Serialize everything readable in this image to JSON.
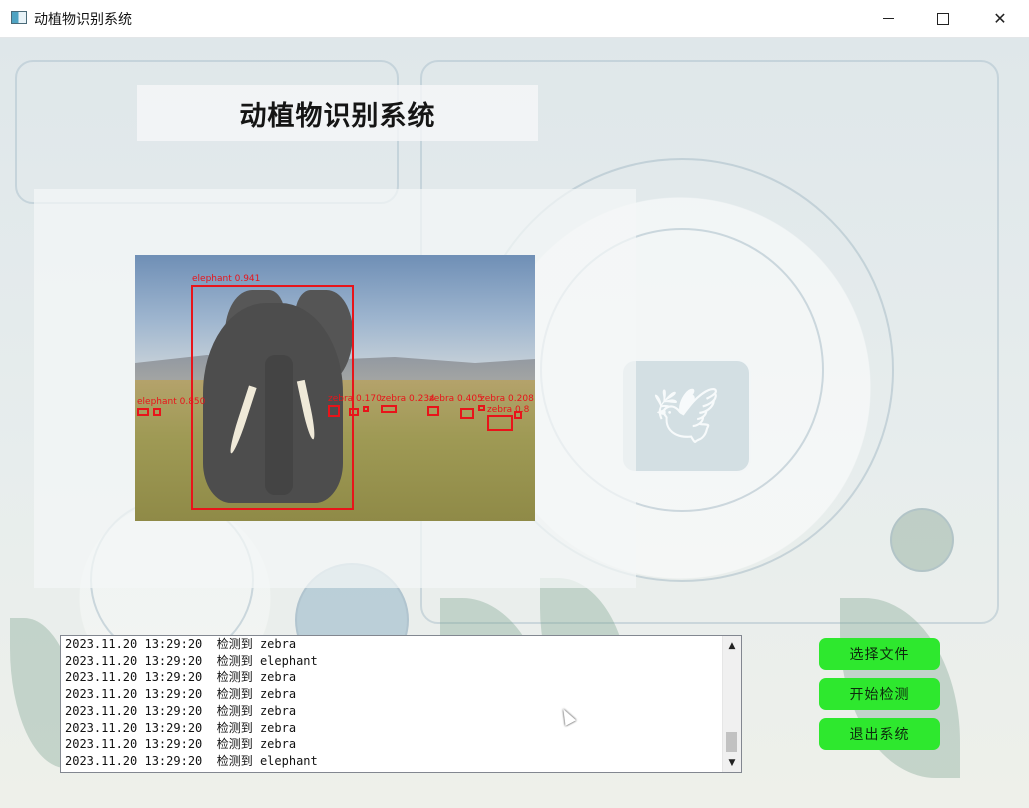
{
  "window": {
    "title": "动植物识别系统",
    "icon": "app-window-icon",
    "controls": [
      "minimize-icon",
      "maximize-icon",
      "close-icon"
    ]
  },
  "header": {
    "title": "动植物识别系统"
  },
  "image_view": {
    "detections": [
      {
        "label": "elephant 0.941"
      },
      {
        "label": "elephant 0.850"
      },
      {
        "label": "zebra 0.170"
      },
      {
        "label": "zebra 0.234"
      },
      {
        "label": "zebra 0.405"
      },
      {
        "label": "zebra 0.208"
      },
      {
        "label": "zebra 0.8"
      }
    ]
  },
  "log": {
    "rows": [
      "2023.11.20 13:29:20  检测到 zebra",
      "2023.11.20 13:29:20  检测到 elephant",
      "2023.11.20 13:29:20  检测到 zebra",
      "2023.11.20 13:29:20  检测到 zebra",
      "2023.11.20 13:29:20  检测到 zebra",
      "2023.11.20 13:29:20  检测到 zebra",
      "2023.11.20 13:29:20  检测到 zebra",
      "2023.11.20 13:29:20  检测到 elephant"
    ]
  },
  "buttons": {
    "select_file": "选择文件",
    "start_detect": "开始检测",
    "exit_system": "退出系统"
  },
  "colors": {
    "button_bg": "#2ee82e",
    "detection_box": "#e8141a"
  }
}
